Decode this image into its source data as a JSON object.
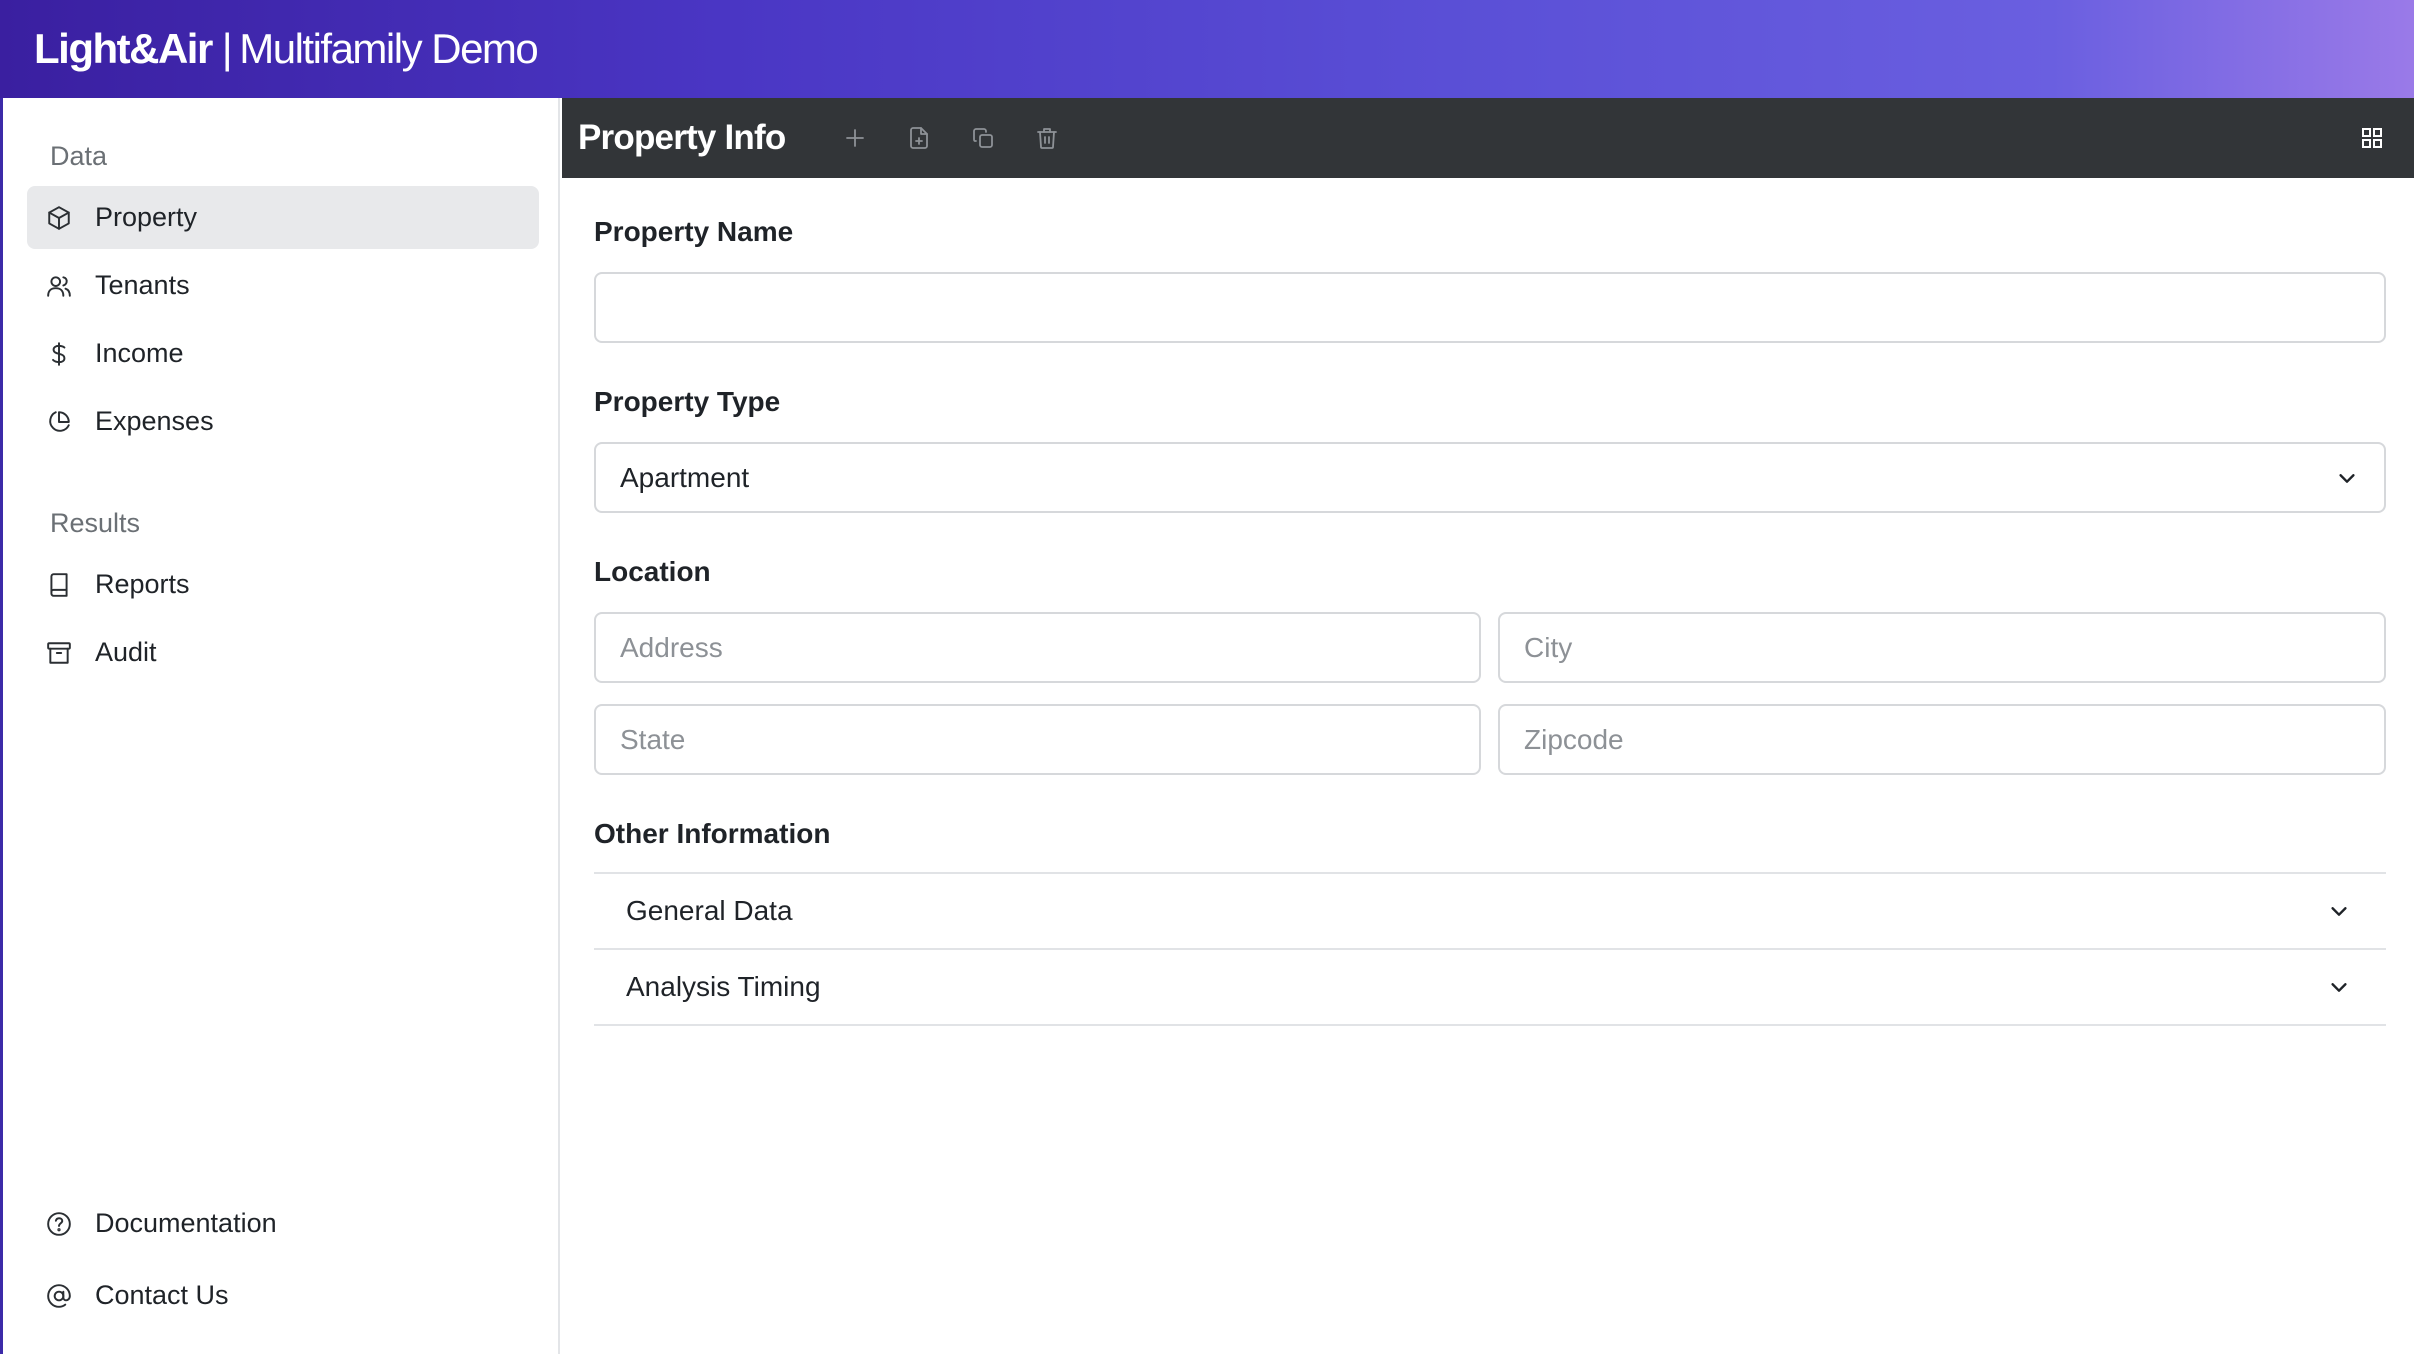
{
  "brand": {
    "name": "Light&Air",
    "separator": "|",
    "subtitle": "Multifamily Demo"
  },
  "sidebar": {
    "sections": [
      {
        "label": "Data"
      },
      {
        "label": "Results"
      }
    ],
    "items": [
      {
        "label": "Property",
        "icon": "cube-icon",
        "active": true
      },
      {
        "label": "Tenants",
        "icon": "users-icon"
      },
      {
        "label": "Income",
        "icon": "dollar-icon"
      },
      {
        "label": "Expenses",
        "icon": "pie-chart-icon"
      },
      {
        "label": "Reports",
        "icon": "book-icon"
      },
      {
        "label": "Audit",
        "icon": "archive-icon"
      }
    ],
    "footer": [
      {
        "label": "Documentation",
        "icon": "help-circle-icon"
      },
      {
        "label": "Contact Us",
        "icon": "at-sign-icon"
      }
    ]
  },
  "header": {
    "title": "Property Info",
    "toolbar": [
      "add-icon",
      "new-file-icon",
      "copy-icon",
      "trash-icon"
    ],
    "layout_icon": "grid-icon",
    "background": "#323538"
  },
  "form": {
    "property_name": {
      "label": "Property Name",
      "value": "",
      "placeholder": ""
    },
    "property_type": {
      "label": "Property Type",
      "value": "Apartment"
    },
    "location": {
      "label": "Location",
      "address_placeholder": "Address",
      "city_placeholder": "City",
      "state_placeholder": "State",
      "zipcode_placeholder": "Zipcode"
    },
    "other": {
      "label": "Other Information",
      "sections": [
        {
          "label": "General Data"
        },
        {
          "label": "Analysis Timing"
        }
      ]
    }
  },
  "colors": {
    "accent_gradient_start": "#3a1fa0",
    "accent_gradient_end": "#9a7ae8",
    "active_nav_bg": "#e8e9eb"
  }
}
